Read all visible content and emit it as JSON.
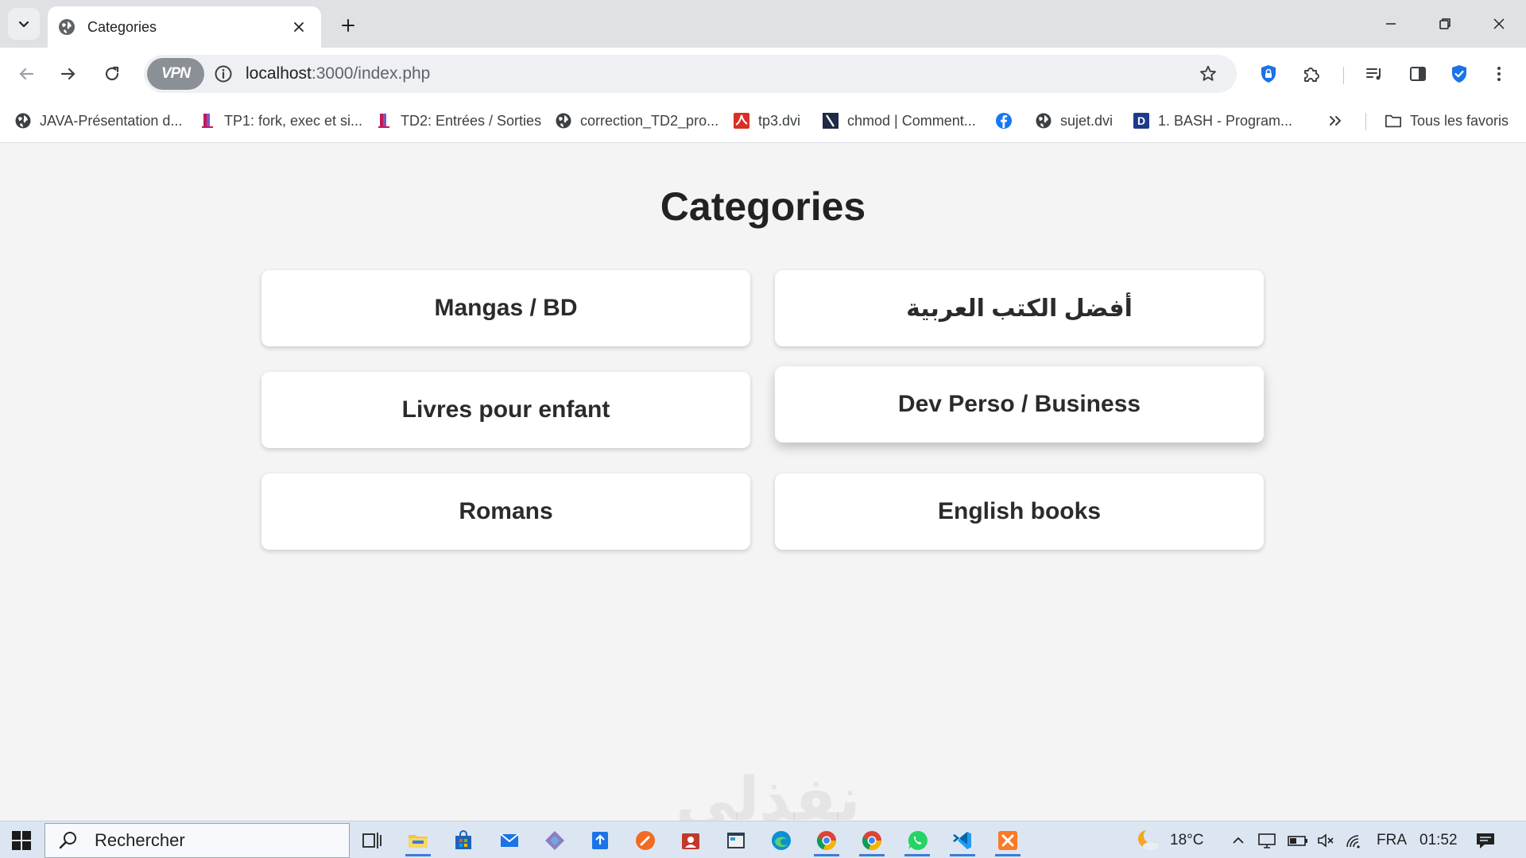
{
  "browser": {
    "tab": {
      "title": "Categories"
    },
    "url": {
      "host": "localhost",
      "rest": ":3000/index.php"
    },
    "vpn_label": "VPN",
    "bookmarks": [
      {
        "label": "JAVA-Présentation d...",
        "icon": "globe-icon"
      },
      {
        "label": "TP1: fork, exec et si...",
        "icon": "bookmark-pink-icon"
      },
      {
        "label": "TD2: Entrées / Sorties",
        "icon": "bookmark-pink-icon"
      },
      {
        "label": "correction_TD2_pro...",
        "icon": "globe-icon"
      },
      {
        "label": "tp3.dvi",
        "icon": "pdf-icon"
      },
      {
        "label": "chmod | Comment...",
        "icon": "bookmark-dark-icon"
      },
      {
        "label": "",
        "icon": "facebook-icon"
      },
      {
        "label": "sujet.dvi",
        "icon": "globe-icon"
      },
      {
        "label": "1. BASH - Program...",
        "icon": "d-square-icon"
      }
    ],
    "all_bookmarks_label": "Tous les favoris"
  },
  "page": {
    "title": "Categories",
    "categories": [
      {
        "label": "Mangas / BD"
      },
      {
        "label": "أفضل الكتب العربية"
      },
      {
        "label": "Livres pour enfant"
      },
      {
        "label": "Dev Perso / Business"
      },
      {
        "label": "Romans"
      },
      {
        "label": "English books"
      }
    ],
    "watermark": "نفذلي"
  },
  "taskbar": {
    "search_placeholder": "Rechercher",
    "weather": "18°C",
    "language": "FRA",
    "time": "01:52"
  },
  "colors": {
    "accent": "#1a73e8",
    "page_bg": "#f4f4f4",
    "card_bg": "#ffffff"
  }
}
